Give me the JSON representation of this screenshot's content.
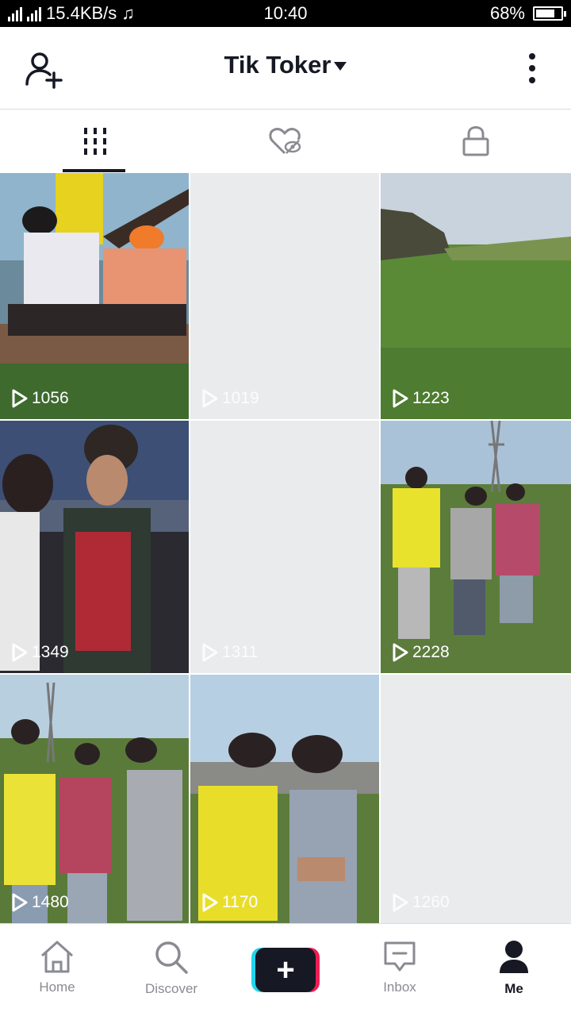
{
  "status_bar": {
    "network_speed": "15.4KB/s",
    "time": "10:40",
    "battery_percent": "68%",
    "battery_level": 0.68
  },
  "header": {
    "title": "Tik Toker",
    "add_user_icon": "add-user-icon",
    "more_icon": "more-vertical-icon"
  },
  "tabs": [
    {
      "name": "videos",
      "icon": "grid-icon",
      "active": true
    },
    {
      "name": "liked",
      "icon": "hidden-heart-icon",
      "active": false
    },
    {
      "name": "private",
      "icon": "lock-icon",
      "active": false
    }
  ],
  "videos": [
    {
      "views": "1056"
    },
    {
      "views": "1019"
    },
    {
      "views": "1223"
    },
    {
      "views": "1349"
    },
    {
      "views": "1311"
    },
    {
      "views": "2228"
    },
    {
      "views": "1480"
    },
    {
      "views": "1170"
    },
    {
      "views": "1260"
    }
  ],
  "bottom_nav": {
    "home": "Home",
    "discover": "Discover",
    "inbox": "Inbox",
    "me": "Me"
  },
  "colors": {
    "text": "#161823",
    "inactive": "#8a8b91",
    "brand_cyan": "#20d5ec",
    "brand_red": "#ee1d52"
  }
}
